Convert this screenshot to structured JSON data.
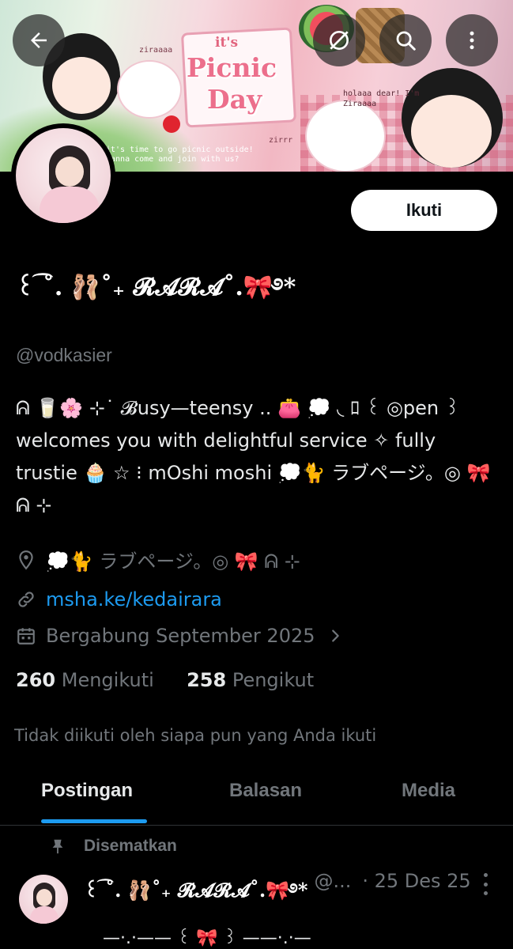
{
  "banner": {
    "its": "it's",
    "picnic": "Picnic",
    "day": "Day",
    "caption_left": "it's time to go picnic outside! wanna come and join with us?",
    "caption_right": "holaaa dear! I'm Ziraaaa",
    "tag_a": "ziraaaa",
    "tag_b": "zirrr"
  },
  "topbar": {
    "back_icon": "arrow-left-icon",
    "mute_icon": "circle-slash-icon",
    "search_icon": "search-icon",
    "more_icon": "more-vertical-icon"
  },
  "profile": {
    "follow_label": "Ikuti",
    "display_name": "꒰ ͡˚. 🩰˚₊ 𝓡𝓐𝓡𝓐˚.🎀࿔*",
    "handle": "@vodkasier",
    "bio": "ᕱ 🥛🌸 ⊹˙ 𝓑usy—teensy .. 👛 💭 ◟ ﾛ ꒰ ◎pen ꒱ welcomes you with delightful service ✧ fully trustie 🧁 ☆ ⁝ mOshi moshi 💭🐈 ラブページ。◎ 🎀 ᕱ ⊹",
    "location": "💭🐈 ラブページ。◎ 🎀 ᕱ ⊹",
    "link": "msha.ke/kedairara",
    "joined": "Bergabung September 2025",
    "following_count": "260",
    "following_label": "Mengikuti",
    "followers_count": "258",
    "followers_label": "Pengikut",
    "not_followed": "Tidak diikuti oleh siapa pun yang Anda ikuti"
  },
  "tabs": [
    {
      "label": "Postingan",
      "active": true
    },
    {
      "label": "Balasan",
      "active": false
    },
    {
      "label": "Media",
      "active": false
    }
  ],
  "post": {
    "pinned_label": "Disematkan",
    "author": "꒰ ͡˚. 🩰˚₊ 𝓡𝓐𝓡𝓐˚.🎀࿔*",
    "handle": "@...",
    "date": "· 25 Des 25",
    "body": "—·.·—— ꒰ 🎀 ꒱ ——·.·—"
  },
  "colors": {
    "background": "#000000",
    "text": "#e7e9ea",
    "muted": "#71767b",
    "accent": "#1d9bf0"
  }
}
